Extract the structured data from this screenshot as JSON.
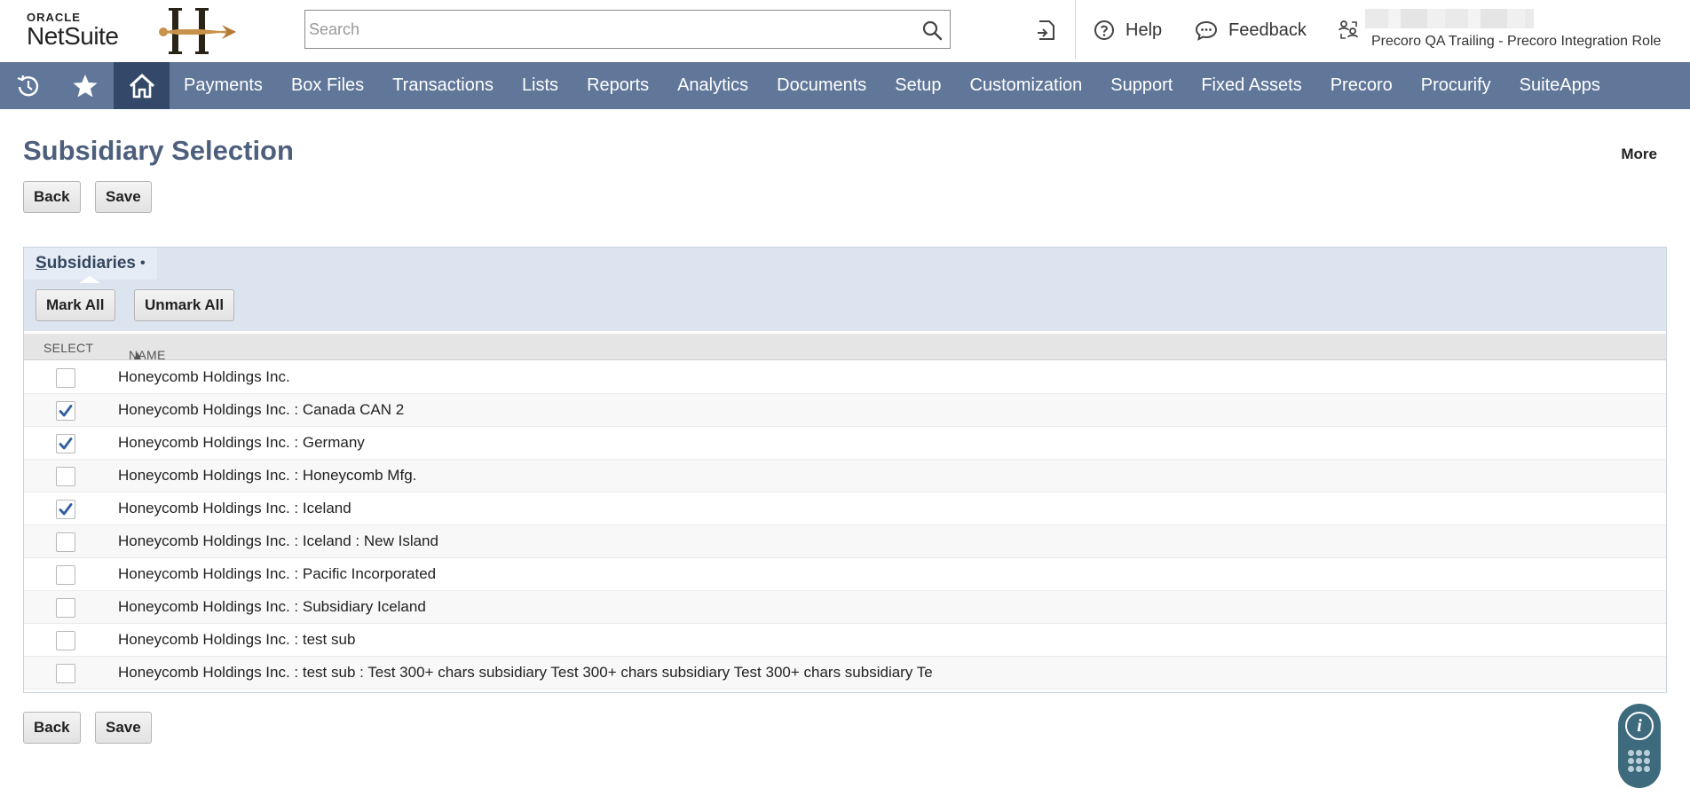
{
  "header": {
    "logo_top": "ORACLE",
    "logo_bottom": "NetSuite",
    "search_placeholder": "Search",
    "help_label": "Help",
    "feedback_label": "Feedback",
    "role_account": "Precoro QA Trailing",
    "role_separator": "-",
    "role_name": "Precoro Integration Role"
  },
  "nav": {
    "items": [
      {
        "label": "Payments"
      },
      {
        "label": "Box Files"
      },
      {
        "label": "Transactions"
      },
      {
        "label": "Lists"
      },
      {
        "label": "Reports"
      },
      {
        "label": "Analytics"
      },
      {
        "label": "Documents"
      },
      {
        "label": "Setup"
      },
      {
        "label": "Customization"
      },
      {
        "label": "Support"
      },
      {
        "label": "Fixed Assets"
      },
      {
        "label": "Precoro"
      },
      {
        "label": "Procurify"
      },
      {
        "label": "SuiteApps"
      }
    ]
  },
  "page": {
    "title": "Subsidiary Selection",
    "more_label": "More",
    "back_label": "Back",
    "save_label": "Save"
  },
  "panel": {
    "tab_first_letter": "S",
    "tab_rest": "ubsidiaries",
    "tab_dot": "•",
    "mark_all_label": "Mark All",
    "unmark_all_label": "Unmark All",
    "col_select": "SELECT",
    "col_name": "NAME",
    "sort_indicator": "▲",
    "rows": [
      {
        "name": "Honeycomb Holdings Inc.",
        "checked": false
      },
      {
        "name": "Honeycomb Holdings Inc. : Canada CAN 2",
        "checked": true
      },
      {
        "name": "Honeycomb Holdings Inc. : Germany",
        "checked": true
      },
      {
        "name": "Honeycomb Holdings Inc. : Honeycomb Mfg.",
        "checked": false
      },
      {
        "name": "Honeycomb Holdings Inc. : Iceland",
        "checked": true
      },
      {
        "name": "Honeycomb Holdings Inc. : Iceland : New Island",
        "checked": false
      },
      {
        "name": "Honeycomb Holdings Inc. : Pacific Incorporated",
        "checked": false
      },
      {
        "name": "Honeycomb Holdings Inc. : Subsidiary Iceland",
        "checked": false
      },
      {
        "name": "Honeycomb Holdings Inc. : test sub",
        "checked": false
      },
      {
        "name": "Honeycomb Holdings Inc. : test sub : Test 300+ chars subsidiary Test 300+ chars subsidiary Test 300+ chars subsidiary Te",
        "checked": false
      }
    ]
  },
  "help_widget": {
    "info_glyph": "i"
  },
  "colors": {
    "nav_bg": "#607799",
    "nav_home_bg": "#34496a",
    "title": "#4d5f7c",
    "panel_band": "#dce4f0",
    "check": "#2f5f9e",
    "help_widget": "#3d6a7c"
  }
}
